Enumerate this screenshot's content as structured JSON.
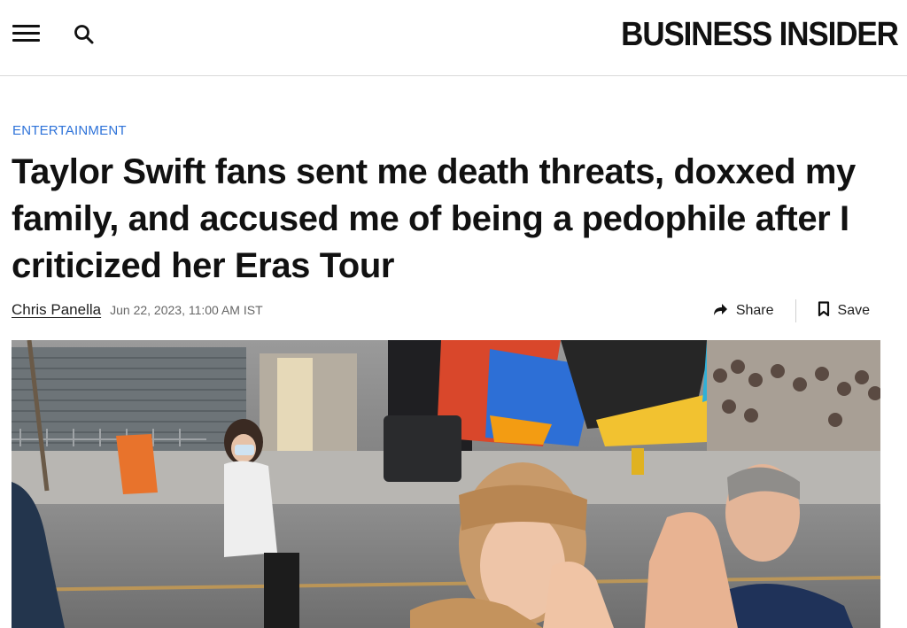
{
  "header": {
    "brand": "BUSINESS INSIDER",
    "menu_icon": "hamburger-menu-icon",
    "search_icon": "search-icon"
  },
  "article": {
    "category": "ENTERTAINMENT",
    "headline": "Taylor Swift fans sent me death threats, doxxed my family, and accused me of being a pedophile after I criticized her Eras Tour",
    "author": "Chris Panella",
    "date": "Jun 22, 2023, 11:00 AM IST"
  },
  "actions": {
    "share_label": "Share",
    "share_icon": "share-arrow-icon",
    "save_label": "Save",
    "save_icon": "bookmark-icon"
  },
  "colors": {
    "category_link": "#2d72d9",
    "text": "#111111",
    "meta": "#666666"
  }
}
